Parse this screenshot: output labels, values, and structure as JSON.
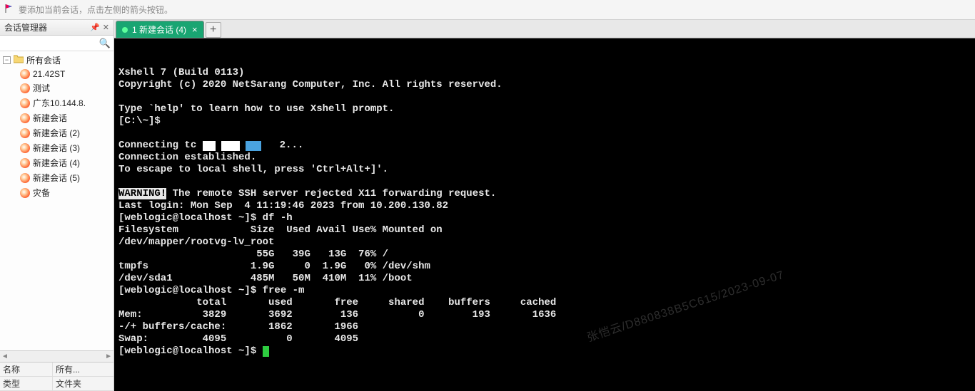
{
  "hint": {
    "text": "要添加当前会话，点击左侧的箭头按钮。"
  },
  "sidebar": {
    "title": "会话管理器",
    "root": "所有会话",
    "items": [
      {
        "label": "21.42ST"
      },
      {
        "label": "测试"
      },
      {
        "label": "广东10.144.8."
      },
      {
        "label": "新建会话"
      },
      {
        "label": "新建会话 (2)"
      },
      {
        "label": "新建会话 (3)"
      },
      {
        "label": "新建会话 (4)"
      },
      {
        "label": "新建会话 (5)"
      },
      {
        "label": "灾备"
      }
    ],
    "props": [
      {
        "label": "名称",
        "value": "所有..."
      },
      {
        "label": "类型",
        "value": "文件夹"
      }
    ]
  },
  "tab": {
    "title": "1 新建会话 (4)"
  },
  "terminal": {
    "lines": [
      "Xshell 7 (Build 0113)",
      "Copyright (c) 2020 NetSarang Computer, Inc. All rights reserved.",
      "",
      "Type `help' to learn how to use Xshell prompt.",
      "[C:\\~]$ ",
      "",
      "Connecting tc               2...",
      "Connection established.",
      "To escape to local shell, press 'Ctrl+Alt+]'.",
      "",
      "WARNING! The remote SSH server rejected X11 forwarding request.",
      "Last login: Mon Sep  4 11:19:46 2023 from 10.200.130.82",
      "[weblogic@localhost ~]$ df -h",
      "Filesystem            Size  Used Avail Use% Mounted on",
      "/dev/mapper/rootvg-lv_root",
      "                       55G   39G   13G  76% /",
      "tmpfs                 1.9G     0  1.9G   0% /dev/shm",
      "/dev/sda1             485M   50M  410M  11% /boot",
      "[weblogic@localhost ~]$ free -m",
      "             total       used       free     shared    buffers     cached",
      "Mem:          3829       3692        136          0        193       1636",
      "-/+ buffers/cache:       1862       1966",
      "Swap:         4095          0       4095",
      "[weblogic@localhost ~]$ "
    ],
    "warning_prefix": "WARNING!",
    "warning_rest": " The remote SSH server rejected X11 forwarding request."
  },
  "watermark": "张恺云/D880838B5C615/2023-09-07",
  "chart_data": {
    "type": "table",
    "tables": [
      {
        "title": "df -h",
        "columns": [
          "Filesystem",
          "Size",
          "Used",
          "Avail",
          "Use%",
          "Mounted on"
        ],
        "rows": [
          [
            "/dev/mapper/rootvg-lv_root",
            "55G",
            "39G",
            "13G",
            "76%",
            "/"
          ],
          [
            "tmpfs",
            "1.9G",
            "0",
            "1.9G",
            "0%",
            "/dev/shm"
          ],
          [
            "/dev/sda1",
            "485M",
            "50M",
            "410M",
            "11%",
            "/boot"
          ]
        ]
      },
      {
        "title": "free -m",
        "columns": [
          "",
          "total",
          "used",
          "free",
          "shared",
          "buffers",
          "cached"
        ],
        "rows": [
          [
            "Mem:",
            3829,
            3692,
            136,
            0,
            193,
            1636
          ],
          [
            "-/+ buffers/cache:",
            "",
            1862,
            1966,
            "",
            "",
            ""
          ],
          [
            "Swap:",
            4095,
            0,
            4095,
            "",
            "",
            ""
          ]
        ]
      }
    ]
  }
}
